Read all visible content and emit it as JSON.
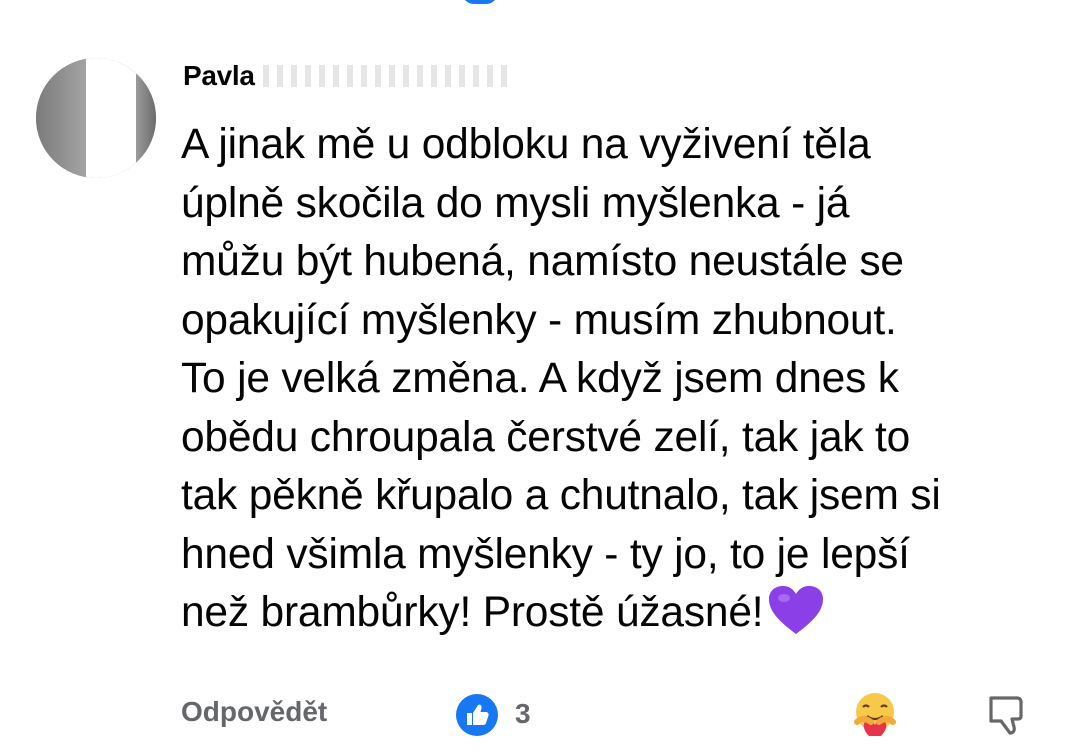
{
  "comment": {
    "author": "Pavla",
    "lines": [
      "A jinak mě u odbloku na vyživení těla",
      "úplně skočila do mysli myšlenka - já",
      "můžu být hubená, namísto neustále se",
      "opakující myšlenky - musím zhubnout.",
      "To je velká změna. A když jsem dnes k",
      "obědu chroupala čerstvé zelí, tak jak to",
      "tak pěkně křupalo a chutnalo, tak jsem si",
      "hned všimla myšlenky - ty jo, to je lepší",
      "než brambůrky!  Prostě úžasné!"
    ],
    "trailing_emoji": "purple-heart"
  },
  "actions": {
    "reply_label": "Odpovědět",
    "reaction_count": "3",
    "reaction_icon": "thumbs-up-icon",
    "react_icon": "care-emoji-icon",
    "dislike_icon": "thumbs-down-icon"
  },
  "colors": {
    "accent": "#1877f2",
    "secondary_text": "#65676b",
    "heart": "#8b3fe6"
  }
}
